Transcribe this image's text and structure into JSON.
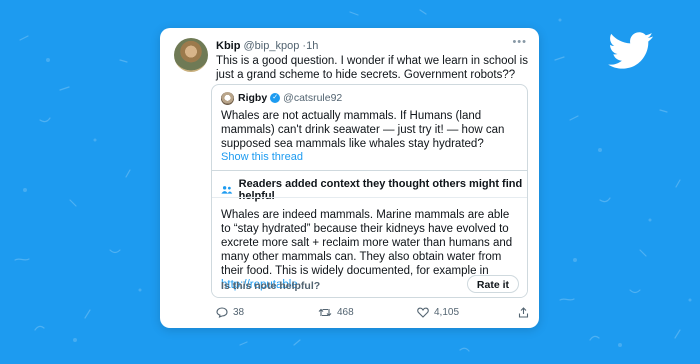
{
  "tweet": {
    "author_name": "Kbip",
    "author_handle": "@bip_kpop",
    "time_sep": "·",
    "time": "1h",
    "text": "This is a good question. I wonder if what we learn in school is just a grand scheme to hide secrets. Government robots??",
    "more_icon": "more-icon"
  },
  "quoted": {
    "author_name": "Rigby",
    "author_handle": "@catsrule92",
    "verified": "✓",
    "text": "Whales are not actually mammals. If Humans (land mammals) can't drink seawater — just try it! — how can supposed sea mammals like whales stay hydrated?",
    "show_thread": "Show this thread"
  },
  "note": {
    "title": "Readers added context they thought others might find helpful",
    "body": "Whales are indeed mammals. Marine mammals are able to “stay hydrated” because their kidneys have evolved to excrete more salt + reclaim more water than humans and many other mammals can. They also obtain water from their food. This is widely documented, for example in ",
    "link": "http://reputable...",
    "helpful_question": "Is this note helpful?",
    "rate_button": "Rate it"
  },
  "actions": {
    "replies": "38",
    "retweets": "468",
    "likes": "4,105"
  },
  "colors": {
    "background": "#1d9bf0",
    "accent": "#1d9bf0"
  }
}
